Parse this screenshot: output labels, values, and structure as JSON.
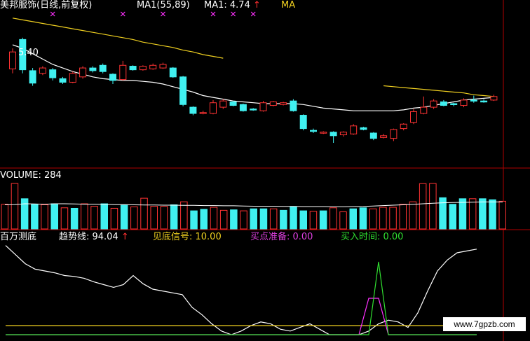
{
  "colors": {
    "up": "#ff3333",
    "down": "#40f0f0",
    "ma_price": "#f0d020",
    "ma_volume": "#f0d020",
    "white_line": "#ffffff",
    "magenta": "#ff30ff",
    "green": "#30e030",
    "label_white": "#ffffff",
    "label_yellow": "#f0d020",
    "label_purple": "#e040e0",
    "divider": "#b00000"
  },
  "icons": {
    "signal_marker": "x-mark-magenta",
    "high_marker": "arrow-up-white"
  },
  "price_panel": {
    "stock_name": "美邦服饰",
    "period_info": "(日线,前复权)",
    "ma_label": "MA1(55,89)",
    "ma1_label": "MA1: 4.74",
    "ma_trunc": "MA",
    "up_arrow": "↑",
    "high_label": "5.40"
  },
  "volume_panel": {
    "label": "VOLUME: 284"
  },
  "indicator_panel": {
    "name": "百万测底",
    "trend_label": "趋势线: 94.04",
    "up_arrow": "↑",
    "bottom_signal": "见底信号: 10.00",
    "buy_prep": "买点准备: 0.00",
    "buy_time": "买入时间: 0.00"
  },
  "watermark": "www.7gpzb.com",
  "chart_data": [
    {
      "type": "candlestick",
      "title": "美邦服饰(日线,前复权)",
      "ylim": [
        4.0,
        5.65
      ],
      "candles": [
        {
          "o": 5.05,
          "c": 5.24,
          "h": 5.28,
          "l": 5.0,
          "up": true
        },
        {
          "o": 5.38,
          "c": 5.04,
          "h": 5.4,
          "l": 5.0,
          "up": false
        },
        {
          "o": 5.03,
          "c": 4.89,
          "h": 5.06,
          "l": 4.86,
          "up": false
        },
        {
          "o": 5.0,
          "c": 5.06,
          "h": 5.08,
          "l": 4.98,
          "up": true
        },
        {
          "o": 5.04,
          "c": 4.95,
          "h": 5.06,
          "l": 4.92,
          "up": false
        },
        {
          "o": 4.94,
          "c": 4.9,
          "h": 4.96,
          "l": 4.88,
          "up": false
        },
        {
          "o": 4.9,
          "c": 5.0,
          "h": 5.02,
          "l": 4.89,
          "up": true
        },
        {
          "o": 4.96,
          "c": 5.06,
          "h": 5.08,
          "l": 4.94,
          "up": true
        },
        {
          "o": 5.06,
          "c": 5.03,
          "h": 5.08,
          "l": 5.01,
          "up": false
        },
        {
          "o": 5.09,
          "c": 5.02,
          "h": 5.11,
          "l": 5.0,
          "up": false
        },
        {
          "o": 4.99,
          "c": 4.92,
          "h": 5.0,
          "l": 4.88,
          "up": false
        },
        {
          "o": 4.93,
          "c": 5.09,
          "h": 5.14,
          "l": 4.92,
          "up": true
        },
        {
          "o": 5.08,
          "c": 5.04,
          "h": 5.09,
          "l": 5.03,
          "up": false
        },
        {
          "o": 5.04,
          "c": 5.08,
          "h": 5.09,
          "l": 5.03,
          "up": true
        },
        {
          "o": 5.05,
          "c": 5.09,
          "h": 5.11,
          "l": 5.04,
          "up": true
        },
        {
          "o": 5.06,
          "c": 5.1,
          "h": 5.12,
          "l": 5.05,
          "up": true
        },
        {
          "o": 5.06,
          "c": 4.96,
          "h": 5.07,
          "l": 4.95,
          "up": false
        },
        {
          "o": 4.96,
          "c": 4.65,
          "h": 4.97,
          "l": 4.63,
          "up": false
        },
        {
          "o": 4.62,
          "c": 4.55,
          "h": 4.63,
          "l": 4.53,
          "up": false
        },
        {
          "o": 4.55,
          "c": 4.56,
          "h": 4.58,
          "l": 4.54,
          "up": true
        },
        {
          "o": 4.55,
          "c": 4.67,
          "h": 4.7,
          "l": 4.54,
          "up": true
        },
        {
          "o": 4.62,
          "c": 4.69,
          "h": 4.71,
          "l": 4.6,
          "up": true
        },
        {
          "o": 4.68,
          "c": 4.64,
          "h": 4.69,
          "l": 4.63,
          "up": false
        },
        {
          "o": 4.65,
          "c": 4.58,
          "h": 4.66,
          "l": 4.57,
          "up": false
        },
        {
          "o": 4.6,
          "c": 4.59,
          "h": 4.61,
          "l": 4.58,
          "up": false
        },
        {
          "o": 4.58,
          "c": 4.67,
          "h": 4.69,
          "l": 4.57,
          "up": true
        },
        {
          "o": 4.64,
          "c": 4.68,
          "h": 4.69,
          "l": 4.63,
          "up": true
        },
        {
          "o": 4.65,
          "c": 4.67,
          "h": 4.68,
          "l": 4.64,
          "up": true
        },
        {
          "o": 4.69,
          "c": 4.58,
          "h": 4.71,
          "l": 4.57,
          "up": false
        },
        {
          "o": 4.53,
          "c": 4.38,
          "h": 4.54,
          "l": 4.36,
          "up": false
        },
        {
          "o": 4.36,
          "c": 4.35,
          "h": 4.38,
          "l": 4.33,
          "up": false
        },
        {
          "o": 4.33,
          "c": 4.34,
          "h": 4.35,
          "l": 4.32,
          "up": true
        },
        {
          "o": 4.34,
          "c": 4.3,
          "h": 4.35,
          "l": 4.22,
          "up": false
        },
        {
          "o": 4.31,
          "c": 4.34,
          "h": 4.35,
          "l": 4.29,
          "up": true
        },
        {
          "o": 4.32,
          "c": 4.41,
          "h": 4.43,
          "l": 4.31,
          "up": true
        },
        {
          "o": 4.39,
          "c": 4.37,
          "h": 4.4,
          "l": 4.36,
          "up": false
        },
        {
          "o": 4.33,
          "c": 4.27,
          "h": 4.34,
          "l": 4.25,
          "up": false
        },
        {
          "o": 4.28,
          "c": 4.3,
          "h": 4.32,
          "l": 4.27,
          "up": true
        },
        {
          "o": 4.27,
          "c": 4.37,
          "h": 4.38,
          "l": 4.24,
          "up": true
        },
        {
          "o": 4.38,
          "c": 4.43,
          "h": 4.44,
          "l": 4.36,
          "up": true
        },
        {
          "o": 4.45,
          "c": 4.57,
          "h": 4.6,
          "l": 4.43,
          "up": true
        },
        {
          "o": 4.55,
          "c": 4.62,
          "h": 4.74,
          "l": 4.54,
          "up": true
        },
        {
          "o": 4.62,
          "c": 4.69,
          "h": 4.71,
          "l": 4.6,
          "up": true
        },
        {
          "o": 4.68,
          "c": 4.64,
          "h": 4.7,
          "l": 4.63,
          "up": false
        },
        {
          "o": 4.66,
          "c": 4.65,
          "h": 4.67,
          "l": 4.63,
          "up": false
        },
        {
          "o": 4.64,
          "c": 4.7,
          "h": 4.72,
          "l": 4.62,
          "up": true
        },
        {
          "o": 4.7,
          "c": 4.69,
          "h": 4.75,
          "l": 4.67,
          "up": false
        },
        {
          "o": 4.69,
          "c": 4.68,
          "h": 4.71,
          "l": 4.67,
          "up": false
        },
        {
          "o": 4.7,
          "c": 4.74,
          "h": 4.76,
          "l": 4.69,
          "up": true
        }
      ],
      "ma_short": [
        5.32,
        5.28,
        5.22,
        5.16,
        5.1,
        5.06,
        5.02,
        4.99,
        4.96,
        4.94,
        4.93,
        4.92,
        4.92,
        4.91,
        4.9,
        4.88,
        4.85,
        4.82,
        4.79,
        4.75,
        4.73,
        4.71,
        4.69,
        4.68,
        4.67,
        4.66,
        4.66,
        4.66,
        4.66,
        4.65,
        4.63,
        4.61,
        4.6,
        4.59,
        4.58,
        4.58,
        4.58,
        4.58,
        4.58,
        4.59,
        4.61,
        4.62,
        4.64,
        4.66,
        4.68,
        4.7,
        4.71,
        4.72,
        4.73
      ],
      "ma_long": [
        5.62,
        5.6,
        5.58,
        5.56,
        5.54,
        5.52,
        5.5,
        5.48,
        5.46,
        5.44,
        5.42,
        5.4,
        5.38,
        5.35,
        5.33,
        5.31,
        5.29,
        5.26,
        5.24,
        5.21,
        5.19,
        5.17
      ],
      "ma_long_tail": [
        4.86,
        4.85,
        4.84,
        4.83,
        4.82,
        4.81,
        4.8,
        4.79,
        4.78,
        4.76,
        4.75,
        4.74
      ]
    },
    {
      "type": "bar",
      "title": "VOLUME",
      "ylim": [
        0,
        700
      ],
      "values": [
        245,
        470,
        300,
        245,
        240,
        250,
        210,
        205,
        250,
        225,
        250,
        205,
        240,
        220,
        305,
        225,
        225,
        240,
        270,
        180,
        195,
        215,
        185,
        190,
        180,
        200,
        200,
        200,
        185,
        220,
        180,
        175,
        180,
        210,
        170,
        200,
        210,
        200,
        215,
        215,
        245,
        270,
        450,
        455,
        310,
        245,
        300,
        300,
        300,
        290,
        275
      ],
      "up": [
        true,
        true,
        false,
        false,
        true,
        false,
        true,
        false,
        true,
        true,
        false,
        true,
        false,
        true,
        true,
        true,
        true,
        false,
        true,
        false,
        false,
        true,
        true,
        false,
        true,
        false,
        false,
        true,
        false,
        false,
        false,
        true,
        false,
        true,
        true,
        false,
        false,
        true,
        true,
        true,
        true,
        true,
        true,
        true,
        false,
        false,
        false,
        true,
        false,
        false,
        true
      ],
      "ma": [
        240,
        242,
        250,
        248,
        245,
        250,
        250,
        248,
        246,
        246,
        244,
        242,
        242,
        240,
        238,
        238,
        236,
        236,
        234,
        234,
        232,
        232,
        230,
        230,
        228,
        226,
        226,
        226,
        224,
        224,
        222,
        222,
        222,
        220,
        220,
        222,
        224,
        228,
        232,
        236,
        240,
        244,
        250,
        256,
        260,
        262,
        264,
        266,
        268,
        268,
        268
      ]
    },
    {
      "type": "line",
      "title": "百万测底",
      "ylim": [
        0,
        100
      ],
      "series": [
        {
          "name": "趋势线",
          "values": [
            98,
            88,
            78,
            72,
            70,
            68,
            65,
            64,
            62,
            58,
            55,
            52,
            55,
            65,
            56,
            50,
            48,
            46,
            44,
            30,
            22,
            12,
            4,
            0,
            4,
            10,
            14,
            12,
            6,
            4,
            8,
            12,
            6,
            0,
            0,
            0,
            0,
            4,
            12,
            16,
            14,
            8,
            24,
            48,
            70,
            82,
            90,
            92,
            94
          ]
        },
        {
          "name": "见底信号",
          "values": [
            10,
            10,
            10,
            10,
            10,
            10,
            10,
            10,
            10,
            10,
            10,
            10,
            10,
            10,
            10,
            10,
            10,
            10,
            10,
            10,
            10,
            10,
            10,
            10,
            10,
            10,
            10,
            10,
            10,
            10,
            10,
            10,
            10,
            10,
            10,
            10,
            10,
            10,
            10,
            10,
            10,
            10,
            10,
            10,
            10,
            10,
            10,
            10,
            10
          ]
        },
        {
          "name": "买点准备",
          "values": [
            0,
            0,
            0,
            0,
            0,
            0,
            0,
            0,
            0,
            0,
            0,
            0,
            0,
            0,
            0,
            0,
            0,
            0,
            0,
            0,
            0,
            0,
            0,
            0,
            0,
            0,
            0,
            0,
            0,
            0,
            0,
            0,
            0,
            0,
            0,
            0,
            0,
            40,
            40,
            0,
            0,
            0,
            0,
            0,
            0,
            0,
            0,
            0,
            0
          ]
        },
        {
          "name": "买入时间",
          "values": [
            0,
            0,
            0,
            0,
            0,
            0,
            0,
            0,
            0,
            0,
            0,
            0,
            0,
            0,
            0,
            0,
            0,
            0,
            0,
            0,
            0,
            0,
            0,
            0,
            0,
            0,
            0,
            0,
            0,
            0,
            0,
            0,
            0,
            0,
            0,
            0,
            0,
            0,
            80,
            0,
            0,
            0,
            0,
            0,
            0,
            0,
            0,
            0,
            0
          ]
        }
      ]
    }
  ]
}
